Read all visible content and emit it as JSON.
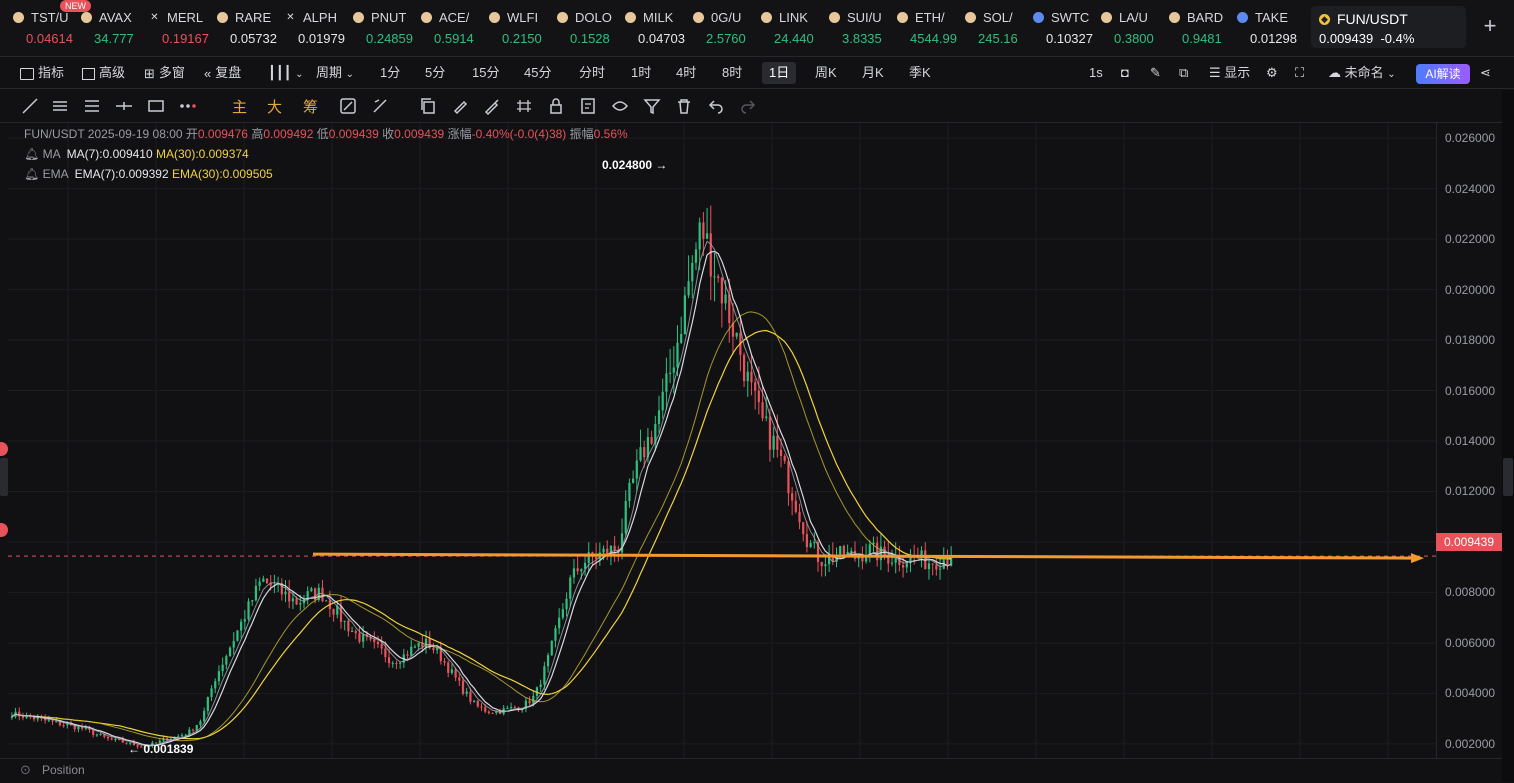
{
  "tickers": [
    {
      "symbol": "TST/U",
      "price": "0.04614",
      "dir": "down",
      "icon": "token-icon",
      "icon_color": "#e8c89a"
    },
    {
      "symbol": "AVAX",
      "price": "34.777",
      "dir": "up",
      "icon": "token-icon",
      "icon_color": "#e8c89a"
    },
    {
      "symbol": "MERL",
      "price": "0.19167",
      "dir": "down",
      "icon": "pinned-x-icon",
      "icon_color": "#d7d8dc"
    },
    {
      "symbol": "RARE",
      "price": "0.05732",
      "dir": "flat",
      "icon": "token-icon",
      "icon_color": "#e8c89a"
    },
    {
      "symbol": "ALPH",
      "price": "0.01979",
      "dir": "flat",
      "icon": "pinned-x-icon",
      "icon_color": "#d7d8dc"
    },
    {
      "symbol": "PNUT",
      "price": "0.24859",
      "dir": "up",
      "icon": "token-icon",
      "icon_color": "#e8c89a"
    },
    {
      "symbol": "ACE/",
      "price": "0.5914",
      "dir": "up",
      "icon": "token-icon",
      "icon_color": "#e8c89a"
    },
    {
      "symbol": "WLFI",
      "price": "0.2150",
      "dir": "up",
      "icon": "token-icon",
      "icon_color": "#e8c89a"
    },
    {
      "symbol": "DOLO",
      "price": "0.1528",
      "dir": "up",
      "icon": "token-icon",
      "icon_color": "#e8c89a"
    },
    {
      "symbol": "MILK",
      "price": "0.04703",
      "dir": "flat",
      "icon": "token-icon",
      "icon_color": "#e8c89a"
    },
    {
      "symbol": "0G/U",
      "price": "2.5760",
      "dir": "up",
      "icon": "token-icon",
      "icon_color": "#e8c89a"
    },
    {
      "symbol": "LINK",
      "price": "24.440",
      "dir": "up",
      "icon": "token-icon",
      "icon_color": "#e8c89a"
    },
    {
      "symbol": "SUI/U",
      "price": "3.8335",
      "dir": "up",
      "icon": "token-icon",
      "icon_color": "#e8c89a"
    },
    {
      "symbol": "ETH/",
      "price": "4544.99",
      "dir": "up",
      "icon": "token-icon",
      "icon_color": "#e8c89a"
    },
    {
      "symbol": "SOL/",
      "price": "245.16",
      "dir": "up",
      "icon": "token-icon",
      "icon_color": "#e8c89a"
    },
    {
      "symbol": "SWTC",
      "price": "0.10327",
      "dir": "flat",
      "icon": "token-icon",
      "icon_color": "#5b8bf0"
    },
    {
      "symbol": "LA/U",
      "price": "0.3800",
      "dir": "up",
      "icon": "token-icon",
      "icon_color": "#e8c89a"
    },
    {
      "symbol": "BARD",
      "price": "0.9481",
      "dir": "up",
      "icon": "token-icon",
      "icon_color": "#e8c89a"
    },
    {
      "symbol": "TAKE",
      "price": "0.01298",
      "dir": "flat",
      "icon": "token-icon",
      "icon_color": "#5b8bf0"
    }
  ],
  "new_badge": "NEW",
  "active_ticker": {
    "symbol": "FUN/USDT",
    "price": "0.009439",
    "change": "-0.4%"
  },
  "toolbar": {
    "indicators": "指标",
    "advanced": "高级",
    "multi_window": "多窗",
    "replay": "复盘",
    "period": "周期",
    "intervals": [
      "1分",
      "5分",
      "15分",
      "45分",
      "分时",
      "1时",
      "4时",
      "8时",
      "1日",
      "周K",
      "月K",
      "季K"
    ],
    "selected_interval": "1日",
    "realtime": "1s",
    "display": "显示",
    "layout_name": "未命名",
    "ai_label": "AI解读"
  },
  "drawbar": {
    "main": "主",
    "large": "大",
    "chips": "筹"
  },
  "info": {
    "pair": "FUN/USDT",
    "date": "2025-09-19 08:00",
    "open_label": "开",
    "open": "0.009476",
    "high_label": "高",
    "high": "0.009492",
    "low_label": "低",
    "low": "0.009439",
    "close_label": "收",
    "close": "0.009439",
    "chg_label": "涨幅",
    "chg": "-0.40%(-0.0(4)38)",
    "amp_label": "振幅",
    "amp": "0.56%",
    "ma_label": "MA",
    "ma7": "MA(7):0.009410",
    "ma30": "MA(30):0.009374",
    "ema_label": "EMA",
    "ema7": "EMA(7):0.009392",
    "ema30": "EMA(30):0.009505"
  },
  "position_label": "Position",
  "chart_data": {
    "type": "candlestick",
    "title": "FUN/USDT 1日",
    "y_ticks": [
      "0.026000",
      "0.024000",
      "0.022000",
      "0.020000",
      "0.018000",
      "0.016000",
      "0.014000",
      "0.012000",
      "0.010000",
      "0.008000",
      "0.006000",
      "0.004000",
      "0.002000"
    ],
    "ylim": [
      0.0014,
      0.0266
    ],
    "last_price": "0.009439",
    "max_label": "0.024800",
    "min_label": "0.001839",
    "colors": {
      "up": "#2fbf7f",
      "down": "#e8525a",
      "ma7": "#d9d9e0",
      "ma30": "#f0d33a",
      "last_line": "#f29a2e"
    },
    "close_series": [
      0.0032,
      0.0031,
      0.003,
      0.0029,
      0.0028,
      0.0027,
      0.0026,
      0.0024,
      0.0022,
      0.0021,
      0.002,
      0.0019,
      0.002,
      0.0022,
      0.0023,
      0.0025,
      0.003,
      0.0045,
      0.0055,
      0.0065,
      0.0075,
      0.0085,
      0.0082,
      0.0079,
      0.0076,
      0.0079,
      0.008,
      0.0074,
      0.0068,
      0.0063,
      0.006,
      0.0057,
      0.0053,
      0.0055,
      0.0059,
      0.006,
      0.0055,
      0.0048,
      0.0041,
      0.0035,
      0.0033,
      0.0033,
      0.0034,
      0.0035,
      0.0039,
      0.0052,
      0.0068,
      0.0085,
      0.0092,
      0.0094,
      0.0096,
      0.0098,
      0.012,
      0.0135,
      0.0145,
      0.016,
      0.018,
      0.0205,
      0.0225,
      0.021,
      0.0195,
      0.018,
      0.0162,
      0.0148,
      0.014,
      0.0128,
      0.0115,
      0.01,
      0.0093,
      0.0094,
      0.0095,
      0.0094,
      0.0097,
      0.0095,
      0.0094,
      0.0093,
      0.0094,
      0.0092,
      0.0093,
      0.0094
    ]
  }
}
